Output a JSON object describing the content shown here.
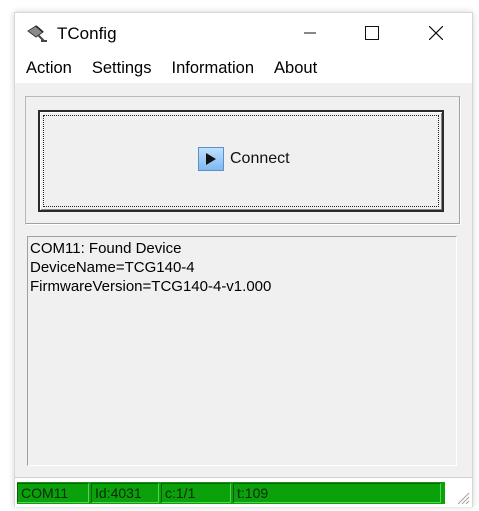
{
  "window": {
    "title": "TConfig"
  },
  "menu": [
    "Action",
    "Settings",
    "Information",
    "About"
  ],
  "connect": {
    "label": "Connect"
  },
  "log": [
    "COM11: Found Device",
    "DeviceName=TCG140-4",
    "FirmwareVersion=TCG140-4-v1.000"
  ],
  "status": [
    "COM11",
    "Id:4031",
    "c:1/1",
    "t:109"
  ],
  "colors": {
    "status_green": "#0aa10a",
    "window_bg": "#f0f0f0"
  },
  "icons": {
    "app": "satellite-dish-icon",
    "connect": "play-icon",
    "resize": "resize-grip-icon"
  }
}
